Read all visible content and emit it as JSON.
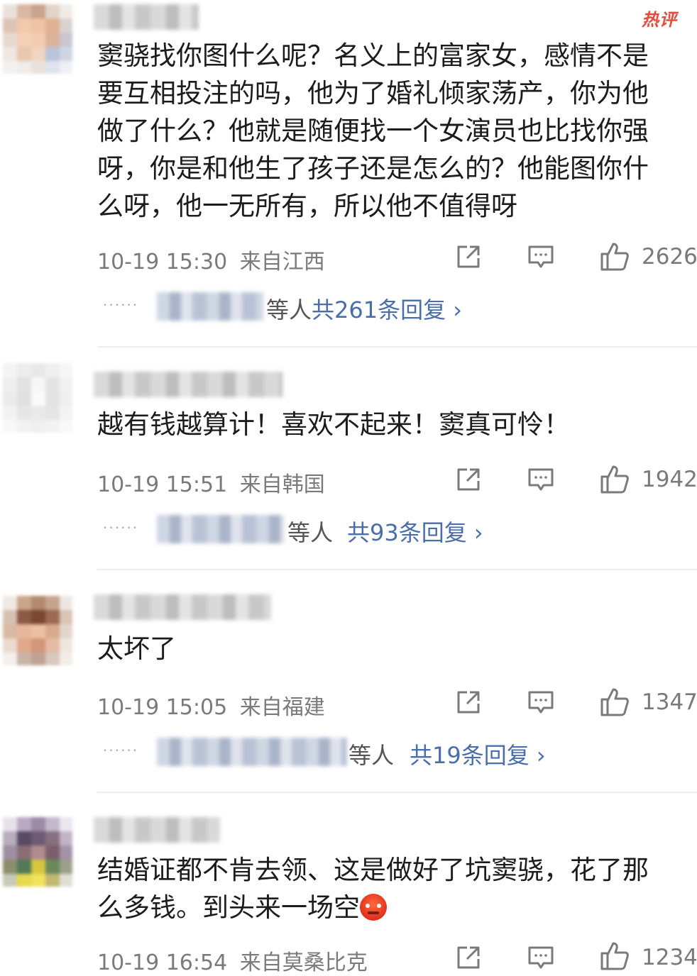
{
  "hot_badge": "热评",
  "comments": [
    {
      "text": "窦骁找你图什么呢？名义上的富家女，感情不是要互相投注的吗，他为了婚礼倾家荡产，你为他做了什么？他就是随便找一个女演员也比找你强呀，你是和他生了孩子还是怎么的？他能图你什么呀，他一无所有，所以他不值得呀",
      "time": "10-19 15:30",
      "location": "来自江西",
      "likes": "2626",
      "deng": "等人",
      "replies": "共261条回复 ›"
    },
    {
      "text": "越有钱越算计！喜欢不起来！窦真可怜！",
      "time": "10-19 15:51",
      "location": "来自韩国",
      "likes": "1942",
      "deng": "等人",
      "replies": "共93条回复 ›"
    },
    {
      "text": "太坏了",
      "time": "10-19 15:05",
      "location": "来自福建",
      "likes": "1347",
      "deng": "等人",
      "replies": "共19条回复 ›"
    },
    {
      "text": "结婚证都不肯去领、这是做好了坑窦骁，花了那么多钱。到头来一场空",
      "time": "10-19 16:54",
      "location": "来自莫桑比克",
      "likes": "1234"
    }
  ],
  "icons": {
    "share": "share-icon",
    "comment": "comment-icon",
    "like": "thumbs-up-icon",
    "emoji": "angry-face-emoji"
  },
  "colors": {
    "hot_badge": "#e64a3b",
    "reply_link": "#4a6ea9",
    "meta_text": "#7a7a7a"
  }
}
